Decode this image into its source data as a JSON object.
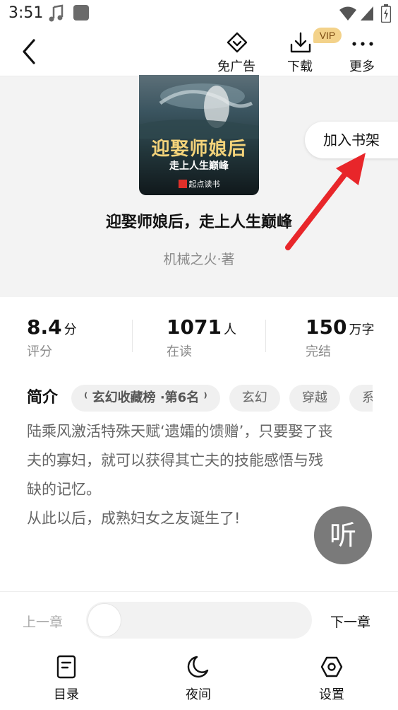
{
  "status_bar": {
    "time": "3:51"
  },
  "top_bar": {
    "no_ads_label": "免广告",
    "download_label": "下载",
    "vip_badge": "VIP",
    "more_label": "更多"
  },
  "book": {
    "title": "迎娶师娘后，走上人生巅峰",
    "author": "机械之火·著",
    "cover": {
      "title": "迎娶师娘后",
      "subtitle": "走上人生巅峰",
      "publisher": "起点读书"
    }
  },
  "add_to_shelf_label": "加入书架",
  "stats": [
    {
      "value": "8.4",
      "unit": "分",
      "label": "评分"
    },
    {
      "value": "1071",
      "unit": "人",
      "label": "在读"
    },
    {
      "value": "150",
      "unit": "万字",
      "label": "完结"
    }
  ],
  "intro": {
    "label": "简介",
    "tags": [
      "玄幻收藏榜 ·第6名",
      "玄幻",
      "穿越",
      "系统"
    ],
    "lines": [
      "陆乘风激活特殊天赋‘遗孀的馈赠’，只要娶了丧",
      "夫的寡妇，就可以获得其亡夫的技能感悟与残",
      "缺的记忆。",
      "从此以后，成熟妇女之友诞生了!"
    ]
  },
  "listen_label": "听",
  "chapter_nav": {
    "prev": "上一章",
    "next": "下一章",
    "progress": 0
  },
  "bottom_nav": [
    {
      "label": "目录",
      "icon": "catalog-icon"
    },
    {
      "label": "夜间",
      "icon": "moon-icon"
    },
    {
      "label": "设置",
      "icon": "settings-icon"
    }
  ],
  "colors": {
    "annotation_arrow": "#e8262a",
    "vip_badge": "#f3d28a"
  }
}
